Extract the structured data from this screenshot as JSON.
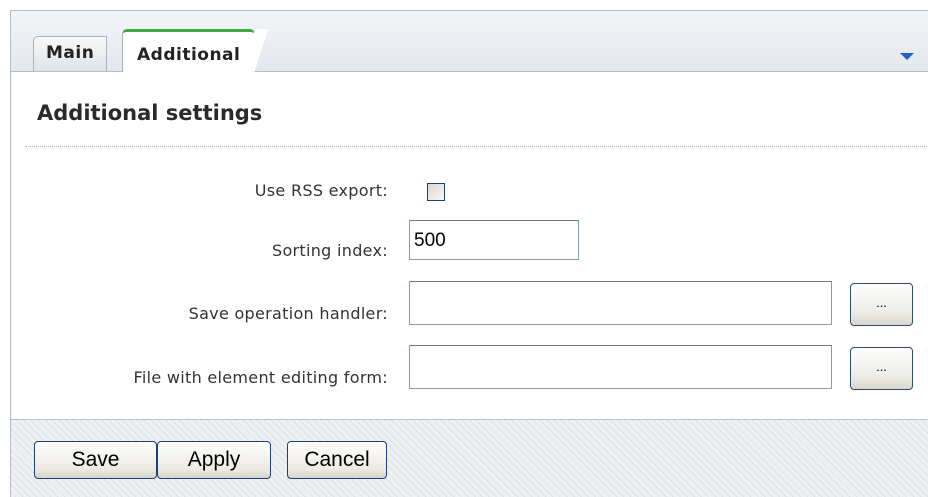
{
  "tabs": [
    {
      "label": "Main",
      "active": false
    },
    {
      "label": "Additional",
      "active": true
    }
  ],
  "section_title": "Additional settings",
  "form": {
    "rss_label": "Use RSS export:",
    "rss_checked": false,
    "sort_label": "Sorting index:",
    "sort_value": "500",
    "save_handler_label": "Save operation handler:",
    "save_handler_value": "",
    "edit_form_label": "File with element editing form:",
    "edit_form_value": "",
    "browse_label": "..."
  },
  "footer": {
    "save_label": "Save",
    "apply_label": "Apply",
    "cancel_label": "Cancel"
  },
  "colors": {
    "active_tab_accent": "#43a843",
    "collapse_arrow": "#1b63c6"
  }
}
